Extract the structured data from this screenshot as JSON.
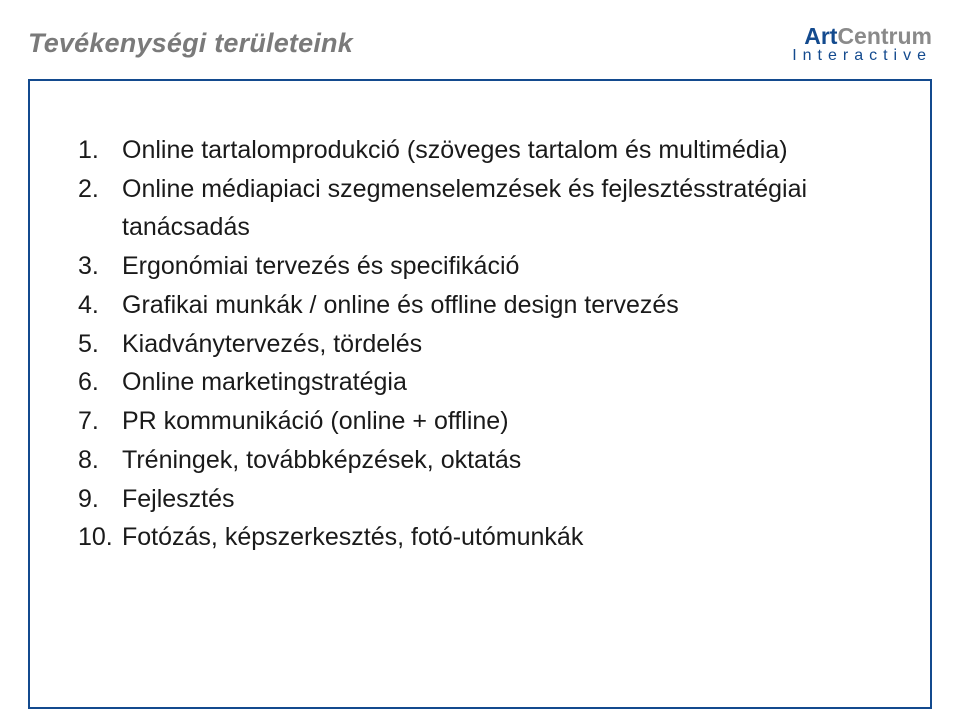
{
  "header": {
    "title": "Tevékenységi területeink",
    "logo": {
      "top1": "Art",
      "top2": "Centrum",
      "bottom": "Interactive"
    }
  },
  "list": [
    {
      "n": "1.",
      "text": "Online tartalomprodukció (szöveges tartalom és multimédia)"
    },
    {
      "n": "2.",
      "text": "Online médiapiaci szegmenselemzések és fejlesztésstratégiai",
      "sub": "tanácsadás"
    },
    {
      "n": "3.",
      "text": "Ergonómiai tervezés és specifikáció"
    },
    {
      "n": "4.",
      "text": "Grafikai munkák / online és offline design tervezés"
    },
    {
      "n": "5.",
      "text": "Kiadványtervezés, tördelés"
    },
    {
      "n": "6.",
      "text": "Online marketingstratégia"
    },
    {
      "n": "7.",
      "text": "PR kommunikáció (online + offline)"
    },
    {
      "n": "8.",
      "text": "Tréningek, továbbképzések, oktatás"
    },
    {
      "n": "9.",
      "text": "Fejlesztés"
    },
    {
      "n": "10.",
      "text": "Fotózás, képszerkesztés, fotó-utómunkák"
    }
  ]
}
